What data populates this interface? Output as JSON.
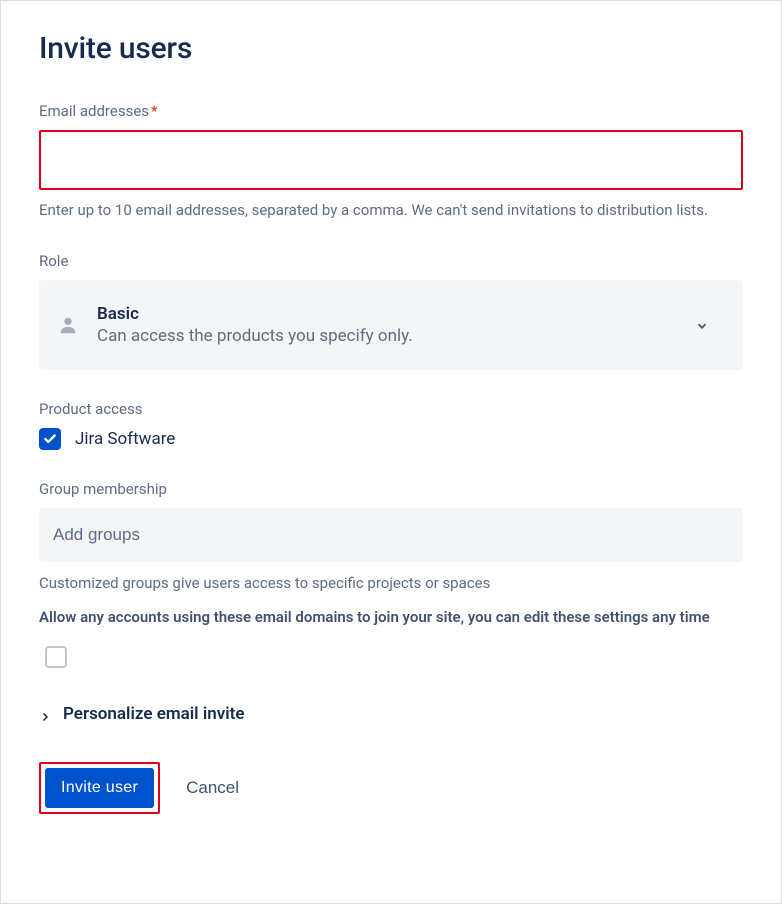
{
  "header": {
    "title": "Invite users"
  },
  "email": {
    "label": "Email addresses",
    "required_mark": "*",
    "value": "",
    "help": "Enter up to 10 email addresses, separated by a comma. We can't send invitations to distribution lists."
  },
  "role": {
    "label": "Role",
    "selected_name": "Basic",
    "selected_desc": "Can access the products you specify only."
  },
  "product_access": {
    "label": "Product access",
    "items": [
      {
        "label": "Jira Software",
        "checked": true
      }
    ]
  },
  "group_membership": {
    "label": "Group membership",
    "placeholder": "Add groups",
    "help": "Customized groups give users access to specific projects or spaces"
  },
  "allow_domains": {
    "text": "Allow any accounts using these email domains to join your site, you can edit these settings any time",
    "checked": false
  },
  "personalize": {
    "label": "Personalize email invite"
  },
  "actions": {
    "invite_label": "Invite   user",
    "cancel_label": "Cancel"
  }
}
